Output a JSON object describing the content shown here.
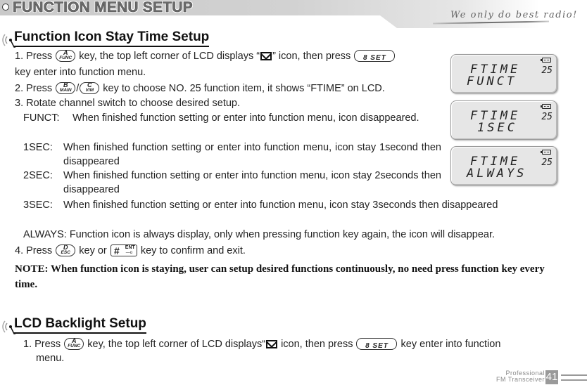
{
  "header": {
    "title": "FUNCTION MENU SETUP",
    "slogan": "We only do best radio!"
  },
  "section1": {
    "title": "Function Icon Stay Time Setup",
    "step1": {
      "pre": "1. Press",
      "mid": "key, the top left corner of LCD displays “",
      "post": "” icon, then press",
      "cont": "key enter into function menu."
    },
    "step2": {
      "pre": "2. Press",
      "sep": "/",
      "post": "key to choose NO. 25 function item, it shows “FTIME” on LCD."
    },
    "step3": "3. Rotate channel switch to choose desired setup.",
    "options": [
      {
        "label": "FUNCT:",
        "text": "When finished function setting or enter into function menu, icon disappeared."
      },
      {
        "label": "1SEC:",
        "text": "When finished function setting or enter into function menu, icon stay 1second then disappeared"
      },
      {
        "label": "2SEC:",
        "text": "When finished function setting or enter into function menu, icon stay 2seconds then disappeared"
      },
      {
        "label": "3SEC:",
        "text": "When finished function setting or enter into function menu, icon stay 3seconds then disappeared"
      },
      {
        "label": "ALWAYS:",
        "text": "Function icon is always display, only when pressing function key again, the icon will disappear."
      }
    ],
    "step4": {
      "pre": "4. Press",
      "mid": "key or",
      "post": "key to confirm and exit."
    },
    "note": "NOTE: When function icon is staying, user can setup desired functions continuously, no need press function key every time."
  },
  "keys": {
    "func": {
      "top": "A",
      "bottom": "FUNC"
    },
    "main": {
      "top": "B",
      "bottom": "MAIN"
    },
    "vm": {
      "top": "C",
      "bottom": "V/M"
    },
    "esc": {
      "top": "D",
      "bottom": "ESC"
    },
    "set": "8 SET",
    "ent": {
      "hash": "#",
      "top": "ENT",
      "bottom": "—o"
    }
  },
  "lcd_panels": [
    {
      "line1": "FTIME",
      "line2": "FUNCT",
      "number": "25"
    },
    {
      "line1": "FTIME",
      "line2": "1SEC",
      "number": "25"
    },
    {
      "line1": "FTIME",
      "line2": "ALWAYS",
      "number": "25"
    }
  ],
  "section2": {
    "title": "LCD Backlight Setup",
    "step1": {
      "pre": "1. Press",
      "mid": "key, the top left corner of LCD displays“",
      "post": " icon, then press",
      "cont": "key enter into function",
      "cont2": "menu."
    }
  },
  "footer": {
    "line1": "Professional",
    "line2": "FM Transceiver",
    "page": "41"
  }
}
